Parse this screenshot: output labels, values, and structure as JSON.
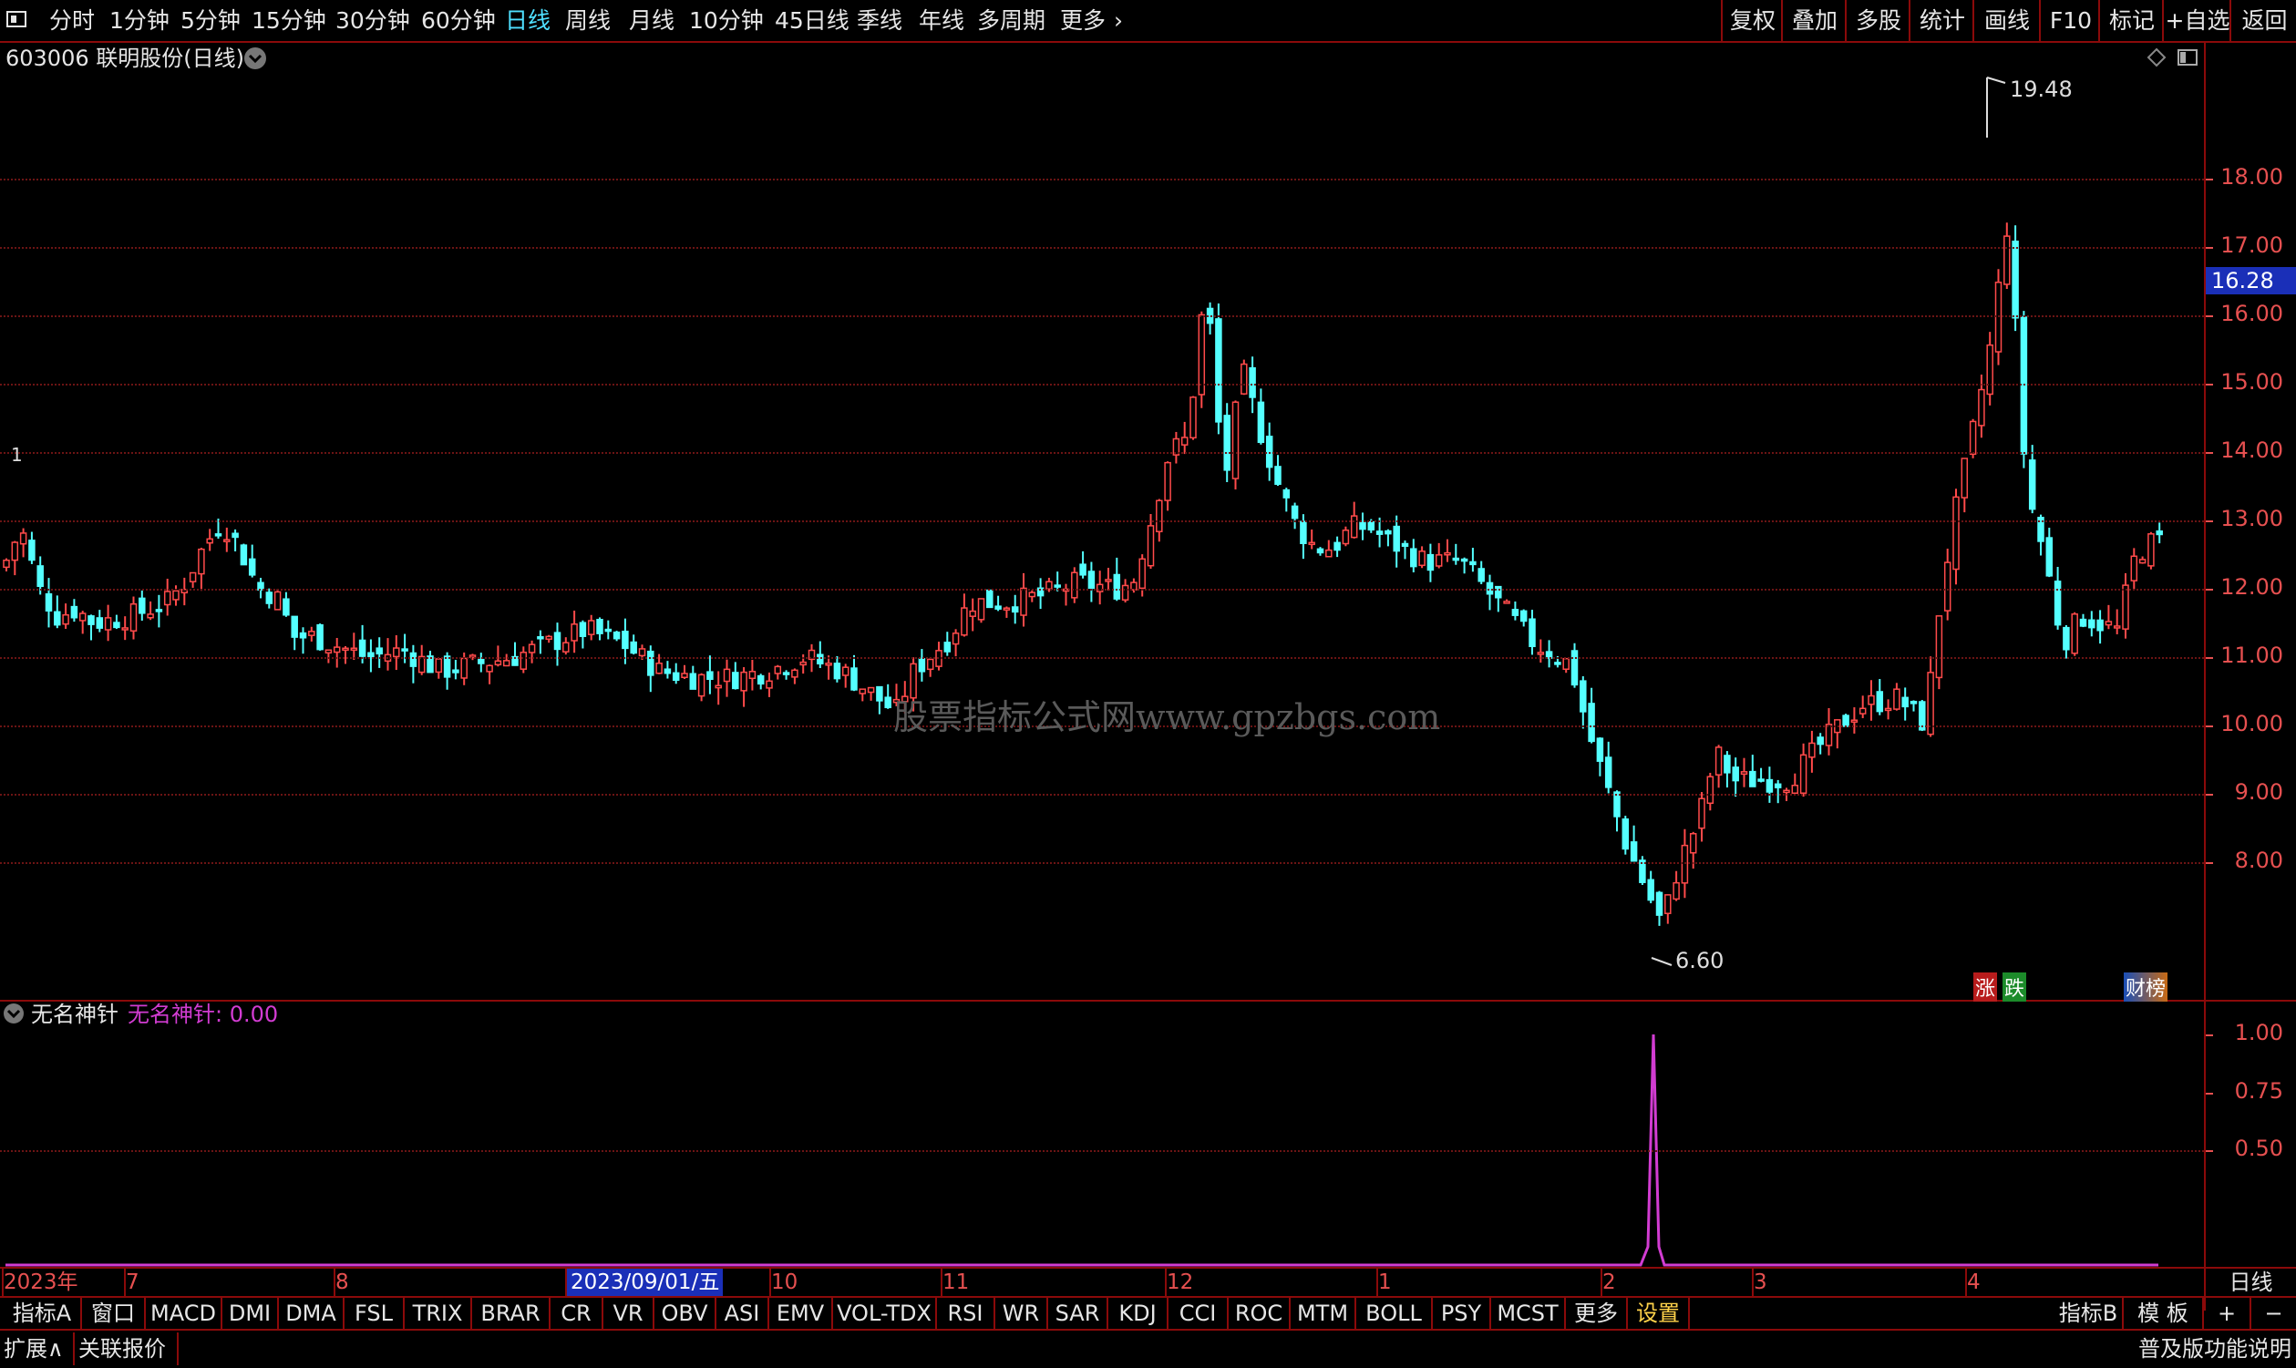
{
  "toolbar": {
    "periods": [
      "分时",
      "1分钟",
      "5分钟",
      "15分钟",
      "30分钟",
      "60分钟",
      "日线",
      "周线",
      "月线",
      "10分钟",
      "45日线",
      "季线",
      "年线",
      "多周期",
      "更多"
    ],
    "right_buttons": [
      "复权",
      "叠加",
      "多股",
      "统计",
      "画线",
      "F10",
      "标记",
      "+自选",
      "返回"
    ]
  },
  "chart_header": {
    "code_name": "603006 联明股份(日线)"
  },
  "price_axis": {
    "labels": [
      "18.00",
      "17.00",
      "16.00",
      "15.00",
      "14.00",
      "13.00",
      "12.00",
      "11.00",
      "10.00",
      "9.00",
      "8.00"
    ],
    "current_price": "16.28"
  },
  "annotations": {
    "high": "19.48",
    "low": "6.60",
    "left_marker": "1",
    "watermark": "股票指标公式网www.gpzbgs.com"
  },
  "badges": {
    "zhang": "涨",
    "die": "跌",
    "caibang": "财榜"
  },
  "indicator": {
    "name": "无名神针",
    "value_label": "无名神针: 0.00",
    "axis": [
      "1.00",
      "0.75",
      "0.50"
    ]
  },
  "x_axis": {
    "labels": [
      "2023年",
      "7",
      "8",
      "2023/09/01/五",
      "10",
      "11",
      "12",
      "1",
      "2",
      "3",
      "4"
    ],
    "corner": "日线"
  },
  "indicator_tabs": [
    "指标A",
    "窗口",
    "MACD",
    "DMI",
    "DMA",
    "FSL",
    "TRIX",
    "BRAR",
    "CR",
    "VR",
    "OBV",
    "ASI",
    "EMV",
    "VOL-TDX",
    "RSI",
    "WR",
    "SAR",
    "KDJ",
    "CCI",
    "ROC",
    "MTM",
    "BOLL",
    "PSY",
    "MCST",
    "更多",
    "设置"
  ],
  "indicator_right": [
    "指标B",
    "模 板",
    "+",
    "−"
  ],
  "status": {
    "expand": "扩展∧",
    "related": "关联报价",
    "pro": "普及版功能说明"
  },
  "colors": {
    "up": "#ff4a4a",
    "down": "#54ffff",
    "grid": "#6b1414",
    "axis": "#e65050",
    "indicator": "#d23cd2",
    "active": "#4fe0ff"
  },
  "chart_data": {
    "type": "candlestick",
    "y_range": [
      6.0,
      20.0
    ],
    "x_month_labels": [
      "2023年",
      "7",
      "8",
      "2023/09/01/五",
      "10",
      "11",
      "12",
      "1",
      "2",
      "3",
      "4"
    ],
    "high": 19.48,
    "low": 6.6,
    "close_last": 12.55,
    "indicator_series": {
      "name": "无名神针",
      "values_note": "0 except spike 1.00 near Feb low"
    }
  }
}
